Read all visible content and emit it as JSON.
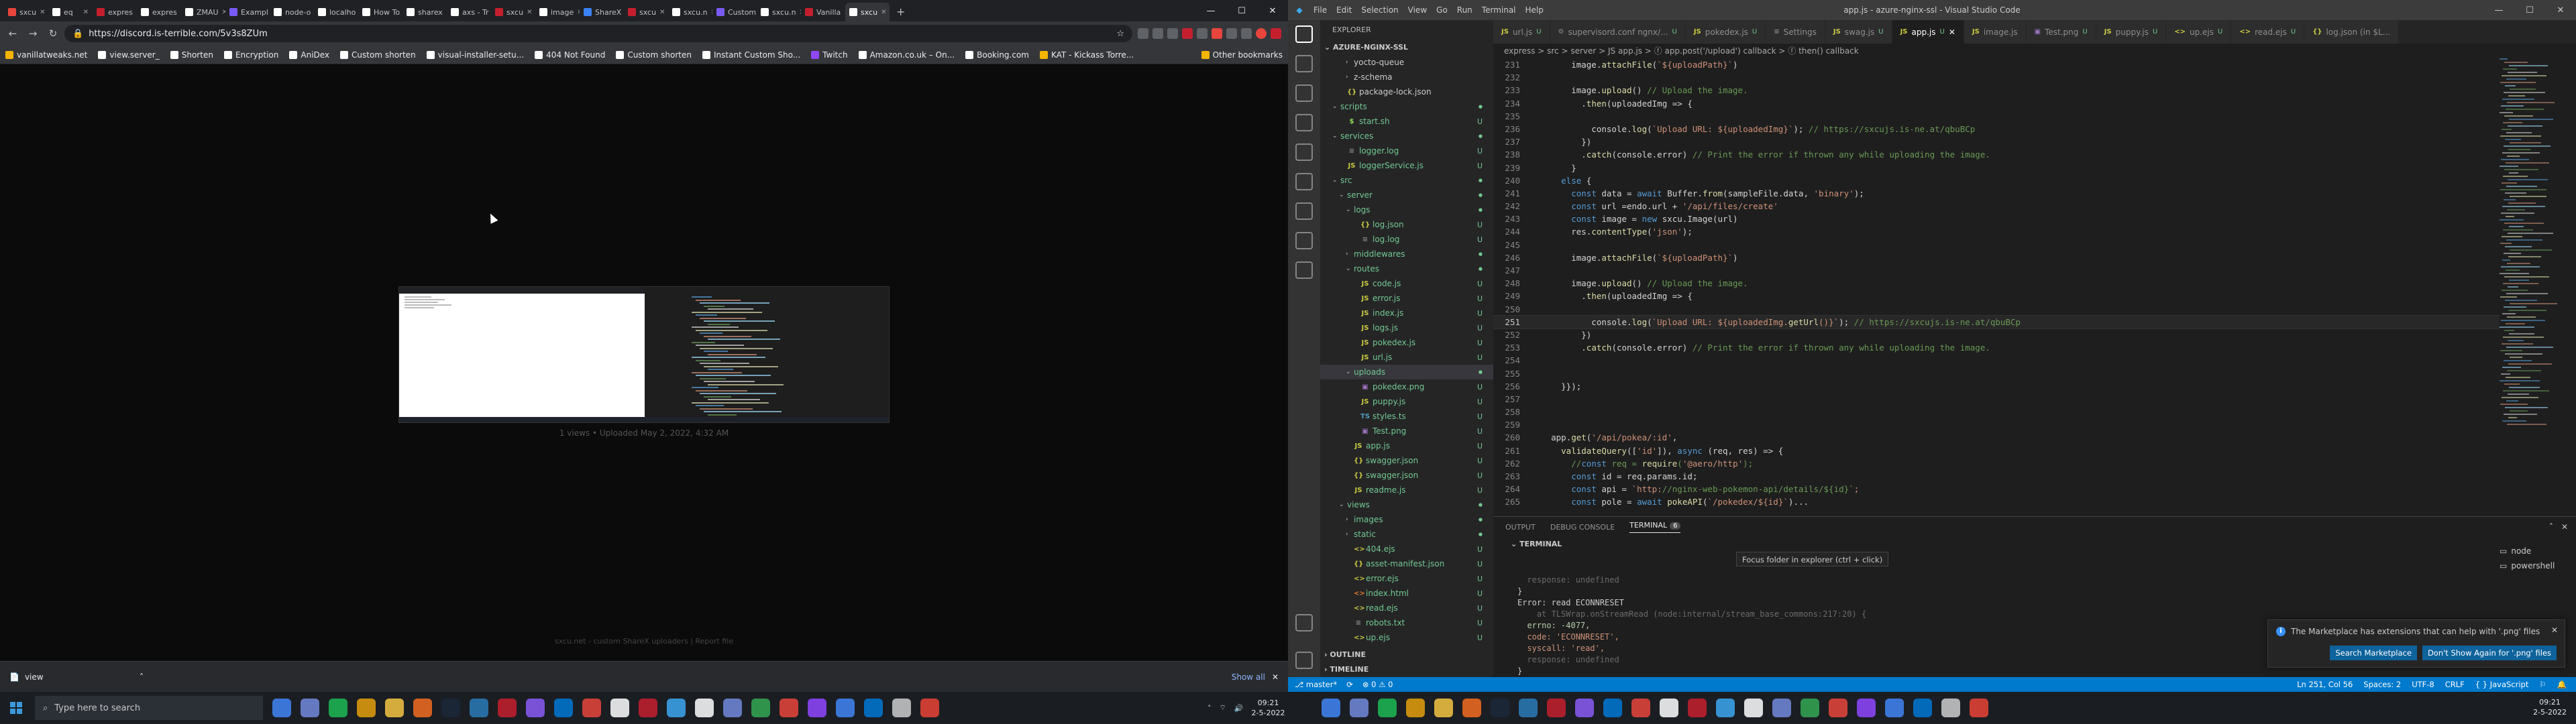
{
  "browser": {
    "tabs": [
      {
        "label": "sxcu",
        "color": "#e8453c",
        "active": false
      },
      {
        "label": "eq",
        "color": "#ffffff",
        "active": false
      },
      {
        "label": "expres",
        "color": "#c51f2e",
        "active": false
      },
      {
        "label": "expres",
        "color": "#ffffff",
        "active": false
      },
      {
        "label": "ZMAU",
        "color": "#ffffff",
        "active": false
      },
      {
        "label": "Exampl",
        "color": "#7a5af5",
        "active": false
      },
      {
        "label": "node-o",
        "color": "#ffffff",
        "active": false
      },
      {
        "label": "localho",
        "color": "#ffffff",
        "active": false
      },
      {
        "label": "How To",
        "color": "#ffffff",
        "active": false
      },
      {
        "label": "sharex",
        "color": "#ffffff",
        "active": false
      },
      {
        "label": "axs - Tr",
        "color": "#ffffff",
        "active": false
      },
      {
        "label": "sxcu",
        "color": "#c51f2e",
        "active": false
      },
      {
        "label": "image",
        "color": "#ffffff",
        "active": false
      },
      {
        "label": "ShareX",
        "color": "#3b82f6",
        "active": false
      },
      {
        "label": "sxcu",
        "color": "#c51f2e",
        "active": false
      },
      {
        "label": "sxcu.n",
        "color": "#ffffff",
        "active": false
      },
      {
        "label": "Custom",
        "color": "#7a5af5",
        "active": false
      },
      {
        "label": "sxcu.n",
        "color": "#ffffff",
        "active": false
      },
      {
        "label": "Vanilla",
        "color": "#c51f2e",
        "active": false
      },
      {
        "label": "sxcu",
        "color": "#ffffff",
        "active": true
      }
    ],
    "url": "https://discord.is-terrible.com/5v3s8ZUm",
    "bookmarks": [
      {
        "label": "vanillatweaks.net",
        "color": "#f4b400"
      },
      {
        "label": "view.server_",
        "color": "#ffffff"
      },
      {
        "label": "Shorten",
        "color": "#ffffff"
      },
      {
        "label": "Encryption",
        "color": "#ffffff"
      },
      {
        "label": "AniDex",
        "color": "#ffffff"
      },
      {
        "label": "Custom shorten",
        "color": "#ffffff"
      },
      {
        "label": "visual-installer-setu...",
        "color": "#ffffff"
      },
      {
        "label": "404 Not Found",
        "color": "#ffffff"
      },
      {
        "label": "Custom shorten",
        "color": "#ffffff"
      },
      {
        "label": "Instant Custom Sho...",
        "color": "#ffffff"
      },
      {
        "label": "Twitch",
        "color": "#9146ff"
      },
      {
        "label": "Amazon.co.uk – On...",
        "color": "#ffffff"
      },
      {
        "label": "Booking.com",
        "color": "#ffffff"
      },
      {
        "label": "KAT - Kickass Torre...",
        "color": "#f4b400"
      }
    ],
    "other_bookmarks": "Other bookmarks",
    "upload_caption": "1 views • Uploaded May 2, 2022, 4:32 AM",
    "footer": "sxcu.net - custom ShareX uploaders | Report file",
    "download_file": "view",
    "show_all": "Show all"
  },
  "vscode": {
    "menu": [
      "File",
      "Edit",
      "Selection",
      "View",
      "Go",
      "Run",
      "Terminal",
      "Help"
    ],
    "window_title": "app.js - azure-nginx-ssl - Visual Studio Code",
    "explorer_title": "EXPLORER",
    "project": "AZURE-NGINX-SSL",
    "tree": [
      {
        "name": "yocto-queue",
        "depth": 3,
        "kind": "folder",
        "badge": "",
        "plain": true
      },
      {
        "name": "z-schema",
        "depth": 3,
        "kind": "folder",
        "badge": "",
        "plain": true
      },
      {
        "name": "package-lock.json",
        "depth": 2,
        "kind": "json",
        "badge": "",
        "plain": true
      },
      {
        "name": "scripts",
        "depth": 1,
        "kind": "folder-open",
        "badge": "",
        "plain": false
      },
      {
        "name": "start.sh",
        "depth": 2,
        "kind": "sh",
        "badge": "U",
        "plain": false
      },
      {
        "name": "services",
        "depth": 1,
        "kind": "folder-open",
        "badge": "",
        "plain": false
      },
      {
        "name": "logger.log",
        "depth": 2,
        "kind": "log",
        "badge": "U",
        "plain": false
      },
      {
        "name": "loggerService.js",
        "depth": 2,
        "kind": "js",
        "badge": "U",
        "plain": false
      },
      {
        "name": "src",
        "depth": 1,
        "kind": "folder-open",
        "badge": "",
        "plain": false
      },
      {
        "name": "server",
        "depth": 2,
        "kind": "folder-open",
        "badge": "",
        "plain": false
      },
      {
        "name": "logs",
        "depth": 3,
        "kind": "folder-open",
        "badge": "",
        "plain": false
      },
      {
        "name": "log.json",
        "depth": 4,
        "kind": "json",
        "badge": "U",
        "plain": false
      },
      {
        "name": "log.log",
        "depth": 4,
        "kind": "log",
        "badge": "U",
        "plain": false
      },
      {
        "name": "middlewares",
        "depth": 3,
        "kind": "folder",
        "badge": "",
        "plain": false
      },
      {
        "name": "routes",
        "depth": 3,
        "kind": "folder-open",
        "badge": "",
        "plain": false
      },
      {
        "name": "code.js",
        "depth": 4,
        "kind": "js",
        "badge": "U",
        "plain": false
      },
      {
        "name": "error.js",
        "depth": 4,
        "kind": "js",
        "badge": "U",
        "plain": false
      },
      {
        "name": "index.js",
        "depth": 4,
        "kind": "js",
        "badge": "U",
        "plain": false
      },
      {
        "name": "logs.js",
        "depth": 4,
        "kind": "js",
        "badge": "U",
        "plain": false
      },
      {
        "name": "pokedex.js",
        "depth": 4,
        "kind": "js",
        "badge": "U",
        "plain": false
      },
      {
        "name": "url.js",
        "depth": 4,
        "kind": "js",
        "badge": "U",
        "plain": false
      },
      {
        "name": "uploads",
        "depth": 3,
        "kind": "folder-open",
        "badge": "",
        "plain": false,
        "selected": true
      },
      {
        "name": "pokedex.png",
        "depth": 4,
        "kind": "png",
        "badge": "U",
        "plain": false
      },
      {
        "name": "puppy.js",
        "depth": 4,
        "kind": "js",
        "badge": "U",
        "plain": false
      },
      {
        "name": "styles.ts",
        "depth": 4,
        "kind": "ts",
        "badge": "U",
        "plain": false
      },
      {
        "name": "Test.png",
        "depth": 4,
        "kind": "png",
        "badge": "U",
        "plain": false
      },
      {
        "name": "app.js",
        "depth": 3,
        "kind": "js",
        "badge": "U",
        "plain": false
      },
      {
        "name": "swagger.json",
        "depth": 3,
        "kind": "json",
        "badge": "U",
        "plain": false
      },
      {
        "name": "swagger.json",
        "depth": 3,
        "kind": "json",
        "badge": "U",
        "plain": false
      },
      {
        "name": "readme.js",
        "depth": 3,
        "kind": "js",
        "badge": "U",
        "plain": false
      },
      {
        "name": "views",
        "depth": 2,
        "kind": "folder-open",
        "badge": "",
        "plain": false
      },
      {
        "name": "images",
        "depth": 3,
        "kind": "folder",
        "badge": "",
        "plain": false
      },
      {
        "name": "static",
        "depth": 3,
        "kind": "folder",
        "badge": "",
        "plain": false
      },
      {
        "name": "404.ejs",
        "depth": 3,
        "kind": "ejs",
        "badge": "U",
        "plain": false
      },
      {
        "name": "asset-manifest.json",
        "depth": 3,
        "kind": "json",
        "badge": "U",
        "plain": false
      },
      {
        "name": "error.ejs",
        "depth": 3,
        "kind": "ejs",
        "badge": "U",
        "plain": false
      },
      {
        "name": "index.html",
        "depth": 3,
        "kind": "html",
        "badge": "U",
        "plain": false
      },
      {
        "name": "read.ejs",
        "depth": 3,
        "kind": "ejs",
        "badge": "U",
        "plain": false
      },
      {
        "name": "robots.txt",
        "depth": 3,
        "kind": "txt",
        "badge": "U",
        "plain": false
      },
      {
        "name": "up.ejs",
        "depth": 3,
        "kind": "ejs",
        "badge": "U",
        "plain": false
      }
    ],
    "outline_label": "OUTLINE",
    "timeline_label": "TIMELINE",
    "editor_tabs": [
      {
        "name": "url.js",
        "icon": "JS",
        "mod": "U",
        "active": false
      },
      {
        "name": "supervisord.conf  ngnx/...",
        "icon": "⚙",
        "mod": "U",
        "active": false
      },
      {
        "name": "pokedex.js",
        "icon": "JS",
        "mod": "U",
        "active": false
      },
      {
        "name": "Settings",
        "icon": "≡",
        "mod": "",
        "active": false
      },
      {
        "name": "swag.js",
        "icon": "JS",
        "mod": "U",
        "active": false
      },
      {
        "name": "app.js",
        "icon": "JS",
        "mod": "U",
        "active": true
      },
      {
        "name": "image.js",
        "icon": "JS",
        "mod": "",
        "active": false
      },
      {
        "name": "Test.png",
        "icon": "▣",
        "mod": "U",
        "active": false
      },
      {
        "name": "puppy.js",
        "icon": "JS",
        "mod": "U",
        "active": false
      },
      {
        "name": "up.ejs",
        "icon": "<>",
        "mod": "U",
        "active": false
      },
      {
        "name": "read.ejs",
        "icon": "<>",
        "mod": "U",
        "active": false
      },
      {
        "name": "log.json (in $L...",
        "icon": "{}",
        "mod": "",
        "active": false
      }
    ],
    "breadcrumb": "express > src > server > JS app.js > ⓕ app.post('/upload') callback > ⓕ then() callback",
    "code": [
      {
        "n": "231",
        "t": "        image.attachFile(`${uploadPath}`)",
        "cur": false
      },
      {
        "n": "232",
        "t": "",
        "cur": false
      },
      {
        "n": "233",
        "t": "        image.upload() // Upload the image.",
        "cur": false
      },
      {
        "n": "234",
        "t": "          .then(uploadedImg => {",
        "cur": false
      },
      {
        "n": "235",
        "t": "",
        "cur": false
      },
      {
        "n": "236",
        "t": "            console.log(`Upload URL: ${uploadedImg}`); // https://sxcujs.is-ne.at/qbuBCp",
        "cur": false
      },
      {
        "n": "237",
        "t": "          })",
        "cur": false
      },
      {
        "n": "238",
        "t": "          .catch(console.error) // Print the error if thrown any while uploading the image.",
        "cur": false
      },
      {
        "n": "239",
        "t": "        }",
        "cur": false
      },
      {
        "n": "240",
        "t": "      else {",
        "cur": false
      },
      {
        "n": "241",
        "t": "        const data = await Buffer.from(sampleFile.data, 'binary');",
        "cur": false
      },
      {
        "n": "242",
        "t": "        const url =endo.url + '/api/files/create'",
        "cur": false
      },
      {
        "n": "243",
        "t": "        const image = new sxcu.Image(url)",
        "cur": false
      },
      {
        "n": "244",
        "t": "        res.contentType('json');",
        "cur": false
      },
      {
        "n": "245",
        "t": "",
        "cur": false
      },
      {
        "n": "246",
        "t": "        image.attachFile(`${uploadPath}`)",
        "cur": false
      },
      {
        "n": "247",
        "t": "",
        "cur": false
      },
      {
        "n": "248",
        "t": "        image.upload() // Upload the image.",
        "cur": false
      },
      {
        "n": "249",
        "t": "          .then(uploadedImg => {",
        "cur": false
      },
      {
        "n": "250",
        "t": "",
        "cur": false
      },
      {
        "n": "251",
        "t": "            console.log(`Upload URL: ${uploadedImg.getUrl()}`); // https://sxcujs.is-ne.at/qbuBCp",
        "cur": true
      },
      {
        "n": "252",
        "t": "          })",
        "cur": false
      },
      {
        "n": "253",
        "t": "          .catch(console.error) // Print the error if thrown any while uploading the image.",
        "cur": false
      },
      {
        "n": "254",
        "t": "",
        "cur": false
      },
      {
        "n": "255",
        "t": "",
        "cur": false
      },
      {
        "n": "256",
        "t": "      }});",
        "cur": false
      },
      {
        "n": "257",
        "t": "",
        "cur": false
      },
      {
        "n": "258",
        "t": "",
        "cur": false
      },
      {
        "n": "259",
        "t": "",
        "cur": false
      },
      {
        "n": "260",
        "t": "    app.get('/api/pokea/:id',",
        "cur": false
      },
      {
        "n": "261",
        "t": "      validateQuery(['id']), async (req, res) => {",
        "cur": false
      },
      {
        "n": "262",
        "t": "        //const req = require('@aero/http');",
        "cur": false
      },
      {
        "n": "263",
        "t": "        const id = req.params.id;",
        "cur": false
      },
      {
        "n": "264",
        "t": "        const api = `http://nginx-web-pokemon-api/details/${id}`;",
        "cur": false
      },
      {
        "n": "265",
        "t": "        const pole = await pokeAPI(`/pokedex/${id}`)...",
        "cur": false
      }
    ],
    "panel_tabs": [
      "OUTPUT",
      "DEBUG CONSOLE",
      "TERMINAL"
    ],
    "terminal_count": "6",
    "terminal_label": "TERMINAL",
    "tooltip": "Focus folder in explorer (ctrl + click)",
    "terminal_lines": [
      "",
      "",
      "  response: undefined",
      "}",
      "Error: read ECONNRESET",
      "    at TLSWrap.onStreamRead (node:internal/stream_base_commons:217:20) {",
      "  errno: -4077,",
      "  code: 'ECONNRESET',",
      "  syscall: 'read',",
      "  response: undefined",
      "}",
      "▯"
    ],
    "terminal_list": [
      "node",
      "powershell"
    ],
    "notification": "The Marketplace has extensions that can help with '.png' files",
    "notif_btn1": "Search Marketplace",
    "notif_btn2": "Don't Show Again for '.png' files",
    "float_labels": [
      "reensh",
      "",
      "",
      "",
      "",
      "lock",
      ""
    ],
    "status_left": [
      "⎇ master*",
      "⟳",
      "⊗ 0 ⚠ 0"
    ],
    "status_right": [
      "Ln 251, Col 56",
      "Spaces: 2",
      "UTF-8",
      "CRLF",
      "{ } JavaScript",
      "⚐",
      "🔔"
    ]
  },
  "taskbar": {
    "search_placeholder": "Type here to search",
    "time": "09:21",
    "date": "2-5-2022",
    "apps_left": [
      "#4285f4",
      "#7289da",
      "#1db954",
      "#e5a00d",
      "#f6c543",
      "#f36c21",
      "#1b2838",
      "#2b7bb9",
      "#c51f2e",
      "#8b5cf6",
      "#0078d4",
      "#e8453c",
      "#ffffff",
      "#c51f2e",
      "#3ca7f0",
      "#ffffff",
      "#7289da",
      "#34a853",
      "#e8453c",
      "#9146ff",
      "#4285f4",
      "#0078d4",
      "#cccccc",
      "#ea4335"
    ],
    "apps_right": [
      "#4285f4",
      "#7289da",
      "#1db954",
      "#e5a00d",
      "#f6c543",
      "#f36c21",
      "#1b2838",
      "#2b7bb9",
      "#c51f2e",
      "#8b5cf6",
      "#0078d4",
      "#e8453c",
      "#ffffff",
      "#c51f2e",
      "#3ca7f0",
      "#ffffff",
      "#7289da",
      "#34a853",
      "#e8453c",
      "#9146ff",
      "#4285f4",
      "#0078d4",
      "#cccccc",
      "#ea4335"
    ]
  }
}
